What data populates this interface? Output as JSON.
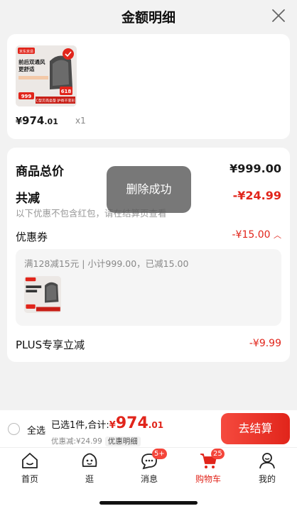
{
  "header": {
    "title": "金额明细"
  },
  "product": {
    "price_symbol": "¥",
    "price_int": "974",
    "price_dec": ".01",
    "quantity": "x1",
    "image_text": {
      "brand": "京东京造",
      "headline1": "前后双通风",
      "headline2": "更舒适",
      "tag": "618",
      "price": "999",
      "strip": "C型贝壳坐垫 护脊不变形"
    }
  },
  "summary": {
    "total_label": "商品总价",
    "total_value": "¥999.00",
    "reduce_label": "共减",
    "reduce_value": "-¥24.99",
    "reduce_note": "以下优惠不包含红包，请在结算页查看",
    "coupon_label": "优惠券",
    "coupon_value": "-¥15.00",
    "coupon_detail": "满128减15元 | 小计999.00，已减15.00",
    "plus_label": "PLUS专享立减",
    "plus_value": "-¥9.99"
  },
  "toast": {
    "text": "删除成功"
  },
  "bottom": {
    "select_all": "全选",
    "selected_prefix": "已选1件,合计:",
    "amount_symbol": "¥",
    "amount_int": "974",
    "amount_dec": ".01",
    "discount": "优惠减:¥24.99",
    "detail_tag": "优惠明细",
    "checkout": "去结算"
  },
  "tabs": [
    {
      "label": "首页",
      "icon": "home-icon"
    },
    {
      "label": "逛",
      "icon": "face-icon"
    },
    {
      "label": "消息",
      "icon": "message-icon",
      "badge": "5+"
    },
    {
      "label": "购物车",
      "icon": "cart-icon",
      "badge": "25",
      "active": true
    },
    {
      "label": "我的",
      "icon": "user-icon"
    }
  ],
  "colors": {
    "accent": "#e1251b",
    "background": "#f2f2f2"
  }
}
